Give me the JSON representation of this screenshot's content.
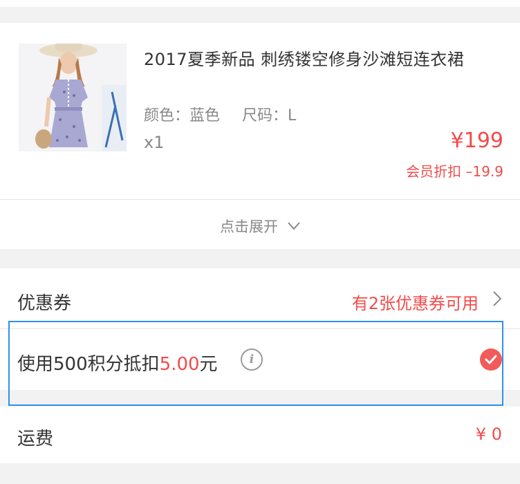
{
  "product": {
    "title": "2017夏季新品 刺绣镂空修身沙滩短连衣裙",
    "color_label": "颜色：",
    "color_value": "蓝色",
    "size_label": "尺码：",
    "size_value": "L",
    "quantity": "x1",
    "price": "¥199",
    "member_discount_label": "会员折扣",
    "member_discount_value": "–19.9",
    "expand_label": "点击展开"
  },
  "coupon": {
    "label": "优惠券",
    "value": "有2张优惠券可用"
  },
  "points": {
    "prefix": "使用500积分抵扣",
    "amount": "5.00",
    "suffix": "元",
    "checked": true
  },
  "shipping": {
    "label": "运费",
    "value": "¥ 0"
  },
  "colors": {
    "accent_red": "#f24b4b",
    "highlight_blue": "#2f8fea"
  }
}
